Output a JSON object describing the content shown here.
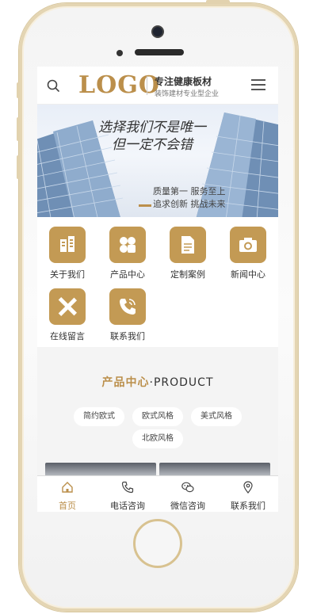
{
  "header": {
    "logo": "LOGO",
    "tagline_main": "专注健康板材",
    "tagline_sub": "装饰建材专业型企业"
  },
  "banner": {
    "title_line1": "选择我们不是唯一",
    "title_line2": "但一定不会错",
    "sub_line1": "质量第一  服务至上",
    "sub_line2": "追求创新  挑战未来"
  },
  "grid": {
    "items": [
      {
        "label": "关于我们",
        "icon": "building-icon"
      },
      {
        "label": "产品中心",
        "icon": "clover-icon"
      },
      {
        "label": "定制案例",
        "icon": "document-icon"
      },
      {
        "label": "新闻中心",
        "icon": "camera-icon"
      },
      {
        "label": "在线留言",
        "icon": "pencil-ruler-icon"
      },
      {
        "label": "联系我们",
        "icon": "phone-icon"
      }
    ]
  },
  "products": {
    "title_cn": "产品中心",
    "title_sep": "·",
    "title_en": "PRODUCT",
    "categories": [
      "简约欧式",
      "欧式风格",
      "美式风格",
      "北欧风格"
    ]
  },
  "bottom_nav": {
    "items": [
      {
        "label": "首页",
        "icon": "home-icon",
        "active": true
      },
      {
        "label": "电话咨询",
        "icon": "phone-icon",
        "active": false
      },
      {
        "label": "微信咨询",
        "icon": "wechat-icon",
        "active": false
      },
      {
        "label": "联系我们",
        "icon": "location-icon",
        "active": false
      }
    ]
  },
  "colors": {
    "accent": "#bb8f4b",
    "icon_bg": "#c39a54"
  }
}
